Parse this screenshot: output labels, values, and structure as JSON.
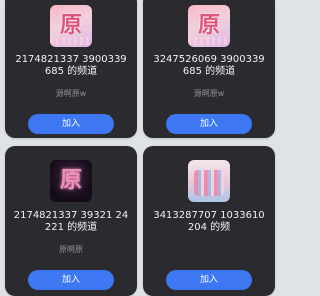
{
  "colors": {
    "card_background": "#2b2b2f",
    "page_background": "#dfe3e8",
    "join_button": "#3d78f2",
    "owner_text": "#8f8f95"
  },
  "channels": [
    {
      "title": "2174821337 3900339685 的频道",
      "owner": "源啊原w",
      "join_label": "加入",
      "thumbnail_text": "原",
      "thumbnail_icon": "pink-anime-avatar-icon"
    },
    {
      "title": "3247526069 3900339685 的频道",
      "owner": "源啊原w",
      "join_label": "加入",
      "thumbnail_text": "原",
      "thumbnail_icon": "pink-anime-avatar-icon"
    },
    {
      "title": "2174821337 39321 24221 的频道",
      "owner": "原啊原",
      "join_label": "加入",
      "thumbnail_text": "原",
      "thumbnail_icon": "dark-pink-avatar-icon"
    },
    {
      "title": "3413287707 1033610204 的频",
      "owner": "",
      "join_label": "加入",
      "thumbnail_text": "",
      "thumbnail_icon": "group-photo-avatar-icon"
    }
  ]
}
